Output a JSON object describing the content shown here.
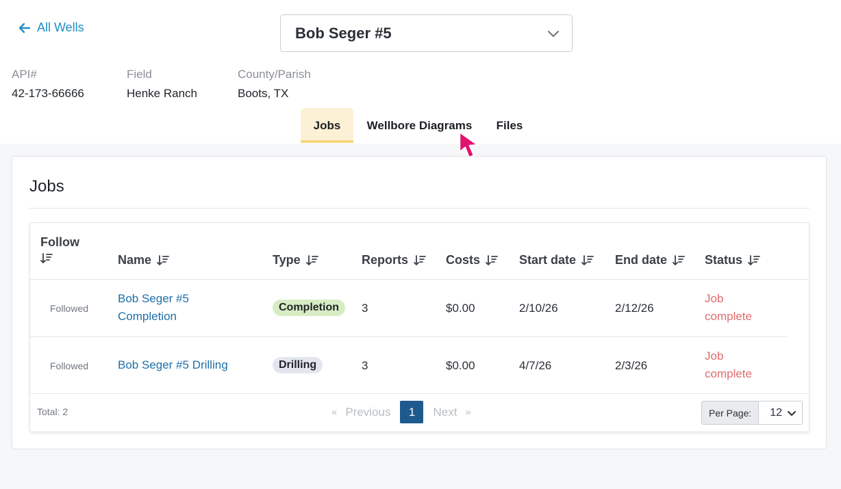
{
  "header": {
    "back_label": "All Wells",
    "well_name": "Bob Seger #5"
  },
  "meta": [
    {
      "label": "API#",
      "value": "42-173-66666"
    },
    {
      "label": "Field",
      "value": "Henke Ranch"
    },
    {
      "label": "County/Parish",
      "value": "Boots, TX"
    }
  ],
  "tabs": [
    {
      "label": "Jobs",
      "active": true
    },
    {
      "label": "Wellbore Diagrams",
      "active": false
    },
    {
      "label": "Files",
      "active": false
    }
  ],
  "jobs": {
    "title": "Jobs",
    "columns": {
      "follow": "Follow",
      "name": "Name",
      "type": "Type",
      "reports": "Reports",
      "costs": "Costs",
      "start": "Start date",
      "end": "End date",
      "status": "Status"
    },
    "rows": [
      {
        "follow": "Followed",
        "name_line1": "Bob Seger #5",
        "name_line2": "Completion",
        "type": "Completion",
        "type_color": "#d7ecc3",
        "reports": "3",
        "costs": "$0.00",
        "start": "2/10/26",
        "end": "2/12/26",
        "status_line1": "Job",
        "status_line2": "complete"
      },
      {
        "follow": "Followed",
        "name_line1": "Bob Seger #5 Drilling",
        "name_line2": "",
        "type": "Drilling",
        "type_color": "#e4e6ef",
        "reports": "3",
        "costs": "$0.00",
        "start": "4/7/26",
        "end": "2/3/26",
        "status_line1": "Job",
        "status_line2": "complete"
      }
    ],
    "footer": {
      "total": "Total: 2",
      "prev_arrow": "«",
      "prev": "Previous",
      "page": "1",
      "next": "Next",
      "next_arrow": "»",
      "per_page_label": "Per Page:",
      "per_page_value": "12"
    }
  },
  "colors": {
    "link": "#1e8fc7",
    "status": "#e06b6b",
    "active_tab": "#fcf1d4",
    "cursor": "#e0146e",
    "page_active": "#1e5a8e"
  }
}
